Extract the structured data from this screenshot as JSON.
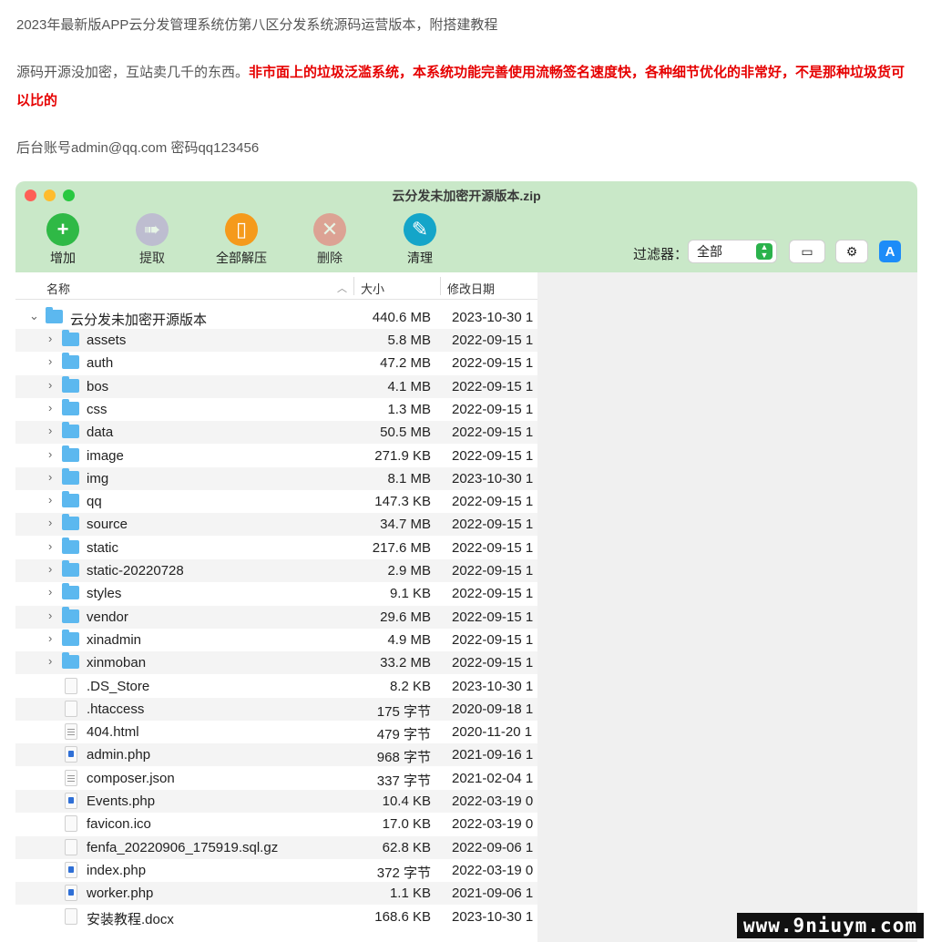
{
  "article": {
    "line1": "2023年最新版APP云分发管理系统仿第八区分发系统源码运营版本，附搭建教程",
    "line2_normal": "源码开源没加密，互站卖几千的东西。",
    "line2_red": "非市面上的垃圾泛滥系统，本系统功能完善使用流畅签名速度快，各种细节优化的非常好，不是那种垃圾货可以比的",
    "line3": "后台账号admin@qq.com  密码qq123456"
  },
  "window": {
    "title": "云分发未加密开源版本.zip",
    "toolbar": {
      "add": "增加",
      "extract": "提取",
      "extract_all": "全部解压",
      "delete": "删除",
      "clean": "清理",
      "filter_label": "过滤器：",
      "filter_value": "全部"
    },
    "columns": {
      "name": "名称",
      "size": "大小",
      "date": "修改日期"
    },
    "root": {
      "name": "云分发未加密开源版本",
      "size": "440.6 MB",
      "date": "2023-10-30 1"
    },
    "rows": [
      {
        "name": "assets",
        "size": "5.8 MB",
        "date": "2022-09-15 1"
      },
      {
        "name": "auth",
        "size": "47.2 MB",
        "date": "2022-09-15 1"
      },
      {
        "name": "bos",
        "size": "4.1 MB",
        "date": "2022-09-15 1"
      },
      {
        "name": "css",
        "size": "1.3 MB",
        "date": "2022-09-15 1"
      },
      {
        "name": "data",
        "size": "50.5 MB",
        "date": "2022-09-15 1"
      },
      {
        "name": "image",
        "size": "271.9 KB",
        "date": "2022-09-15 1"
      },
      {
        "name": "img",
        "size": "8.1 MB",
        "date": "2023-10-30 1"
      },
      {
        "name": "qq",
        "size": "147.3 KB",
        "date": "2022-09-15 1"
      },
      {
        "name": "source",
        "size": "34.7 MB",
        "date": "2022-09-15 1"
      },
      {
        "name": "static",
        "size": "217.6 MB",
        "date": "2022-09-15 1"
      },
      {
        "name": "static-20220728",
        "size": "2.9 MB",
        "date": "2022-09-15 1"
      },
      {
        "name": "styles",
        "size": "9.1 KB",
        "date": "2022-09-15 1"
      },
      {
        "name": "vendor",
        "size": "29.6 MB",
        "date": "2022-09-15 1"
      },
      {
        "name": "xinadmin",
        "size": "4.9 MB",
        "date": "2022-09-15 1"
      },
      {
        "name": "xinmoban",
        "size": "33.2 MB",
        "date": "2022-09-15 1"
      },
      {
        "name": ".DS_Store",
        "size": "8.2 KB",
        "date": "2023-10-30 1"
      },
      {
        "name": ".htaccess",
        "size": "175 字节",
        "date": "2020-09-18 1"
      },
      {
        "name": "404.html",
        "size": "479 字节",
        "date": "2020-11-20 1"
      },
      {
        "name": "admin.php",
        "size": "968 字节",
        "date": "2021-09-16 1"
      },
      {
        "name": "composer.json",
        "size": "337 字节",
        "date": "2021-02-04 1"
      },
      {
        "name": "Events.php",
        "size": "10.4 KB",
        "date": "2022-03-19 0"
      },
      {
        "name": "favicon.ico",
        "size": "17.0 KB",
        "date": "2022-03-19 0"
      },
      {
        "name": "fenfa_20220906_175919.sql.gz",
        "size": "62.8 KB",
        "date": "2022-09-06 1"
      },
      {
        "name": "index.php",
        "size": "372 字节",
        "date": "2022-03-19 0"
      },
      {
        "name": "worker.php",
        "size": "1.1 KB",
        "date": "2021-09-06 1"
      },
      {
        "name": "安装教程.docx",
        "size": "168.6 KB",
        "date": "2023-10-30 1"
      }
    ]
  },
  "watermark": "www.9niuym.com",
  "colors": {
    "titlebar": "#c9e8c8",
    "red_text": "#e60000",
    "folder": "#5cb8ef"
  }
}
